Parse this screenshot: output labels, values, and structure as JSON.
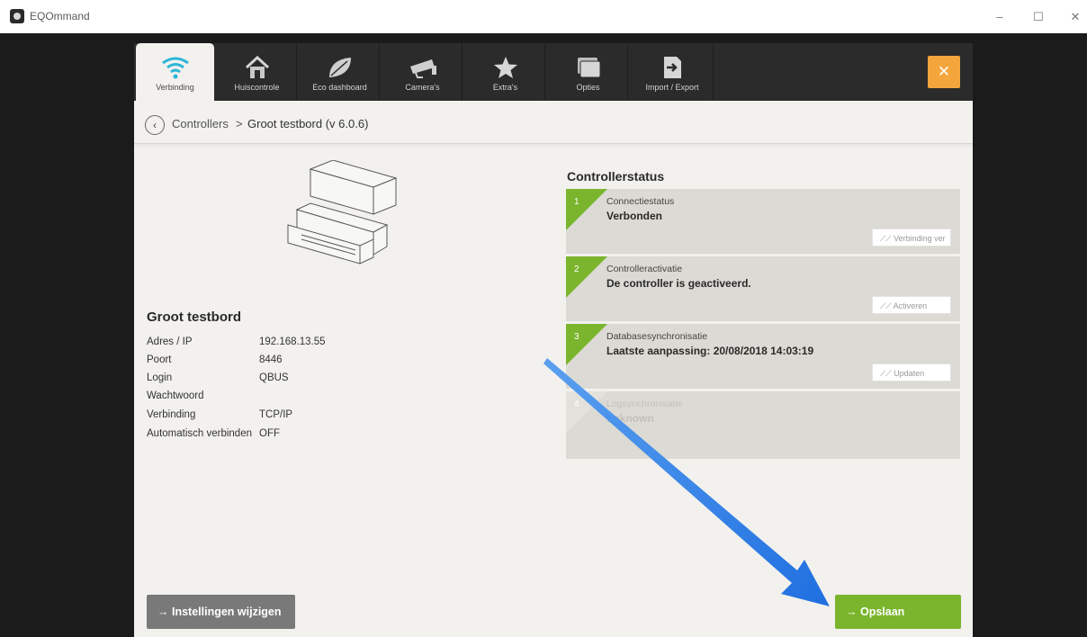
{
  "app": {
    "title": "EQOmmand"
  },
  "window_controls": {
    "minimize": "–",
    "maximize": "☐",
    "close": "✕"
  },
  "tabs": [
    {
      "label": "Verbinding",
      "icon": "wifi-icon"
    },
    {
      "label": "Huiscontrole",
      "icon": "home-icon"
    },
    {
      "label": "Eco dashboard",
      "icon": "leaf-icon"
    },
    {
      "label": "Camera's",
      "icon": "camera-icon"
    },
    {
      "label": "Extra's",
      "icon": "star-icon"
    },
    {
      "label": "Opties",
      "icon": "windows-icon"
    },
    {
      "label": "Import / Export",
      "icon": "import-export-icon"
    }
  ],
  "close_symbol": "✕",
  "breadcrumb": {
    "back": "‹",
    "parent": "Controllers",
    "separator": ">",
    "current": "Groot testbord (v 6.0.6)"
  },
  "controller": {
    "name": "Groot testbord",
    "properties": [
      {
        "label": "Adres / IP",
        "value": "192.168.13.55"
      },
      {
        "label": "Poort",
        "value": "8446"
      },
      {
        "label": "Login",
        "value": "QBUS"
      },
      {
        "label": "Wachtwoord",
        "value": ""
      },
      {
        "label": "Verbinding",
        "value": "TCP/IP"
      },
      {
        "label": "Automatisch verbinden",
        "value": "OFF"
      }
    ]
  },
  "status": {
    "title": "Controllerstatus",
    "cards": [
      {
        "num": "1",
        "label": "Connectiestatus",
        "value": "Verbonden",
        "button": "⟋⟋ Verbinding ver"
      },
      {
        "num": "2",
        "label": "Controlleractivatie",
        "value": "De controller is geactiveerd.",
        "button": "⟋⟋ Activeren"
      },
      {
        "num": "3",
        "label": "Databasesynchronisatie",
        "value": "Laatste aanpassing: 20/08/2018 14:03:19",
        "button": "⟋⟋ Updaten"
      },
      {
        "num": "4",
        "label": "Logsynchronisatie",
        "value": "unknown",
        "button": ""
      }
    ]
  },
  "buttons": {
    "edit": "→  Instellingen wijzigen",
    "save": "→  Opslaan"
  },
  "colors": {
    "accent_green": "#7ab52d",
    "close_orange": "#f4a53b",
    "arrow_blue": "#2f7de8"
  }
}
